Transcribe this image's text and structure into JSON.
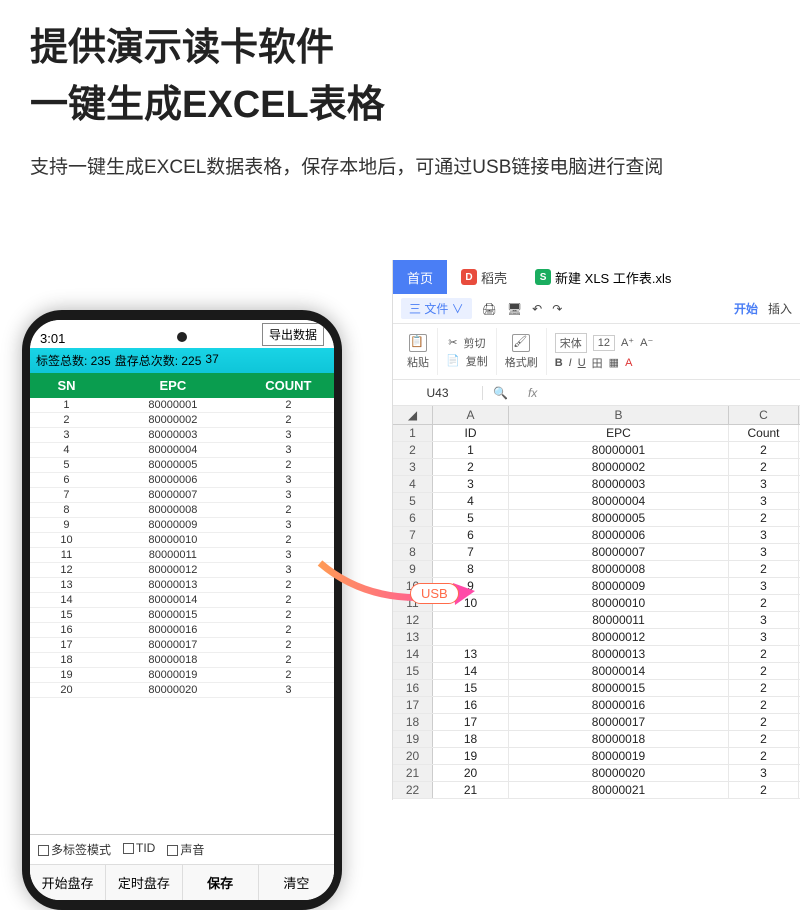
{
  "title_l1": "提供演示读卡软件",
  "title_l2": "一键生成EXCEL表格",
  "desc": "支持一键生成EXCEL数据表格，保存本地后，可通过USB链接电脑进行查阅",
  "usb_label": "USB",
  "device": {
    "time": "3:01",
    "export_btn": "导出数据",
    "summary": {
      "tags": "标签总数: 235",
      "rounds": "盘存总次数: 225",
      "extra": "37"
    },
    "header": {
      "sn": "SN",
      "epc": "EPC",
      "count": "COUNT"
    },
    "rows": [
      {
        "sn": "1",
        "epc": "80000001",
        "count": "2"
      },
      {
        "sn": "2",
        "epc": "80000002",
        "count": "2"
      },
      {
        "sn": "3",
        "epc": "80000003",
        "count": "3"
      },
      {
        "sn": "4",
        "epc": "80000004",
        "count": "3"
      },
      {
        "sn": "5",
        "epc": "80000005",
        "count": "2"
      },
      {
        "sn": "6",
        "epc": "80000006",
        "count": "3"
      },
      {
        "sn": "7",
        "epc": "80000007",
        "count": "3"
      },
      {
        "sn": "8",
        "epc": "80000008",
        "count": "2"
      },
      {
        "sn": "9",
        "epc": "80000009",
        "count": "3"
      },
      {
        "sn": "10",
        "epc": "80000010",
        "count": "2"
      },
      {
        "sn": "11",
        "epc": "80000011",
        "count": "3"
      },
      {
        "sn": "12",
        "epc": "80000012",
        "count": "3"
      },
      {
        "sn": "13",
        "epc": "80000013",
        "count": "2"
      },
      {
        "sn": "14",
        "epc": "80000014",
        "count": "2"
      },
      {
        "sn": "15",
        "epc": "80000015",
        "count": "2"
      },
      {
        "sn": "16",
        "epc": "80000016",
        "count": "2"
      },
      {
        "sn": "17",
        "epc": "80000017",
        "count": "2"
      },
      {
        "sn": "18",
        "epc": "80000018",
        "count": "2"
      },
      {
        "sn": "19",
        "epc": "80000019",
        "count": "2"
      },
      {
        "sn": "20",
        "epc": "80000020",
        "count": "3"
      }
    ],
    "checks": {
      "multi": "多标签模式",
      "tid": "TID",
      "sound": "声音"
    },
    "buttons": {
      "start": "开始盘存",
      "timed": "定时盘存",
      "save": "保存",
      "clear": "清空"
    }
  },
  "excel": {
    "tabs": {
      "home": "首页",
      "doc": "稻壳",
      "file": "新建 XLS 工作表.xls"
    },
    "menu": {
      "file": "三 文件 ∨",
      "start": "开始",
      "insert": "插入"
    },
    "ribbon": {
      "cut": "剪切",
      "copy": "复制",
      "fmt": "格式刷",
      "paste": "粘贴",
      "font": "宋体",
      "size": "12"
    },
    "cell_ref": "U43",
    "fx": "fx",
    "headers": {
      "a": "A",
      "b": "B",
      "c": "C"
    },
    "title_row": {
      "a": "ID",
      "b": "EPC",
      "c": "Count"
    },
    "rows": [
      {
        "n": "2",
        "a": "1",
        "b": "80000001",
        "c": "2"
      },
      {
        "n": "3",
        "a": "2",
        "b": "80000002",
        "c": "2"
      },
      {
        "n": "4",
        "a": "3",
        "b": "80000003",
        "c": "3"
      },
      {
        "n": "5",
        "a": "4",
        "b": "80000004",
        "c": "3"
      },
      {
        "n": "6",
        "a": "5",
        "b": "80000005",
        "c": "2"
      },
      {
        "n": "7",
        "a": "6",
        "b": "80000006",
        "c": "3"
      },
      {
        "n": "8",
        "a": "7",
        "b": "80000007",
        "c": "3"
      },
      {
        "n": "9",
        "a": "8",
        "b": "80000008",
        "c": "2"
      },
      {
        "n": "10",
        "a": "9",
        "b": "80000009",
        "c": "3"
      },
      {
        "n": "11",
        "a": "10",
        "b": "80000010",
        "c": "2"
      },
      {
        "n": "12",
        "a": "",
        "b": "80000011",
        "c": "3"
      },
      {
        "n": "13",
        "a": "",
        "b": "80000012",
        "c": "3"
      },
      {
        "n": "14",
        "a": "13",
        "b": "80000013",
        "c": "2"
      },
      {
        "n": "15",
        "a": "14",
        "b": "80000014",
        "c": "2"
      },
      {
        "n": "16",
        "a": "15",
        "b": "80000015",
        "c": "2"
      },
      {
        "n": "17",
        "a": "16",
        "b": "80000016",
        "c": "2"
      },
      {
        "n": "18",
        "a": "17",
        "b": "80000017",
        "c": "2"
      },
      {
        "n": "19",
        "a": "18",
        "b": "80000018",
        "c": "2"
      },
      {
        "n": "20",
        "a": "19",
        "b": "80000019",
        "c": "2"
      },
      {
        "n": "21",
        "a": "20",
        "b": "80000020",
        "c": "3"
      },
      {
        "n": "22",
        "a": "21",
        "b": "80000021",
        "c": "2"
      }
    ]
  }
}
